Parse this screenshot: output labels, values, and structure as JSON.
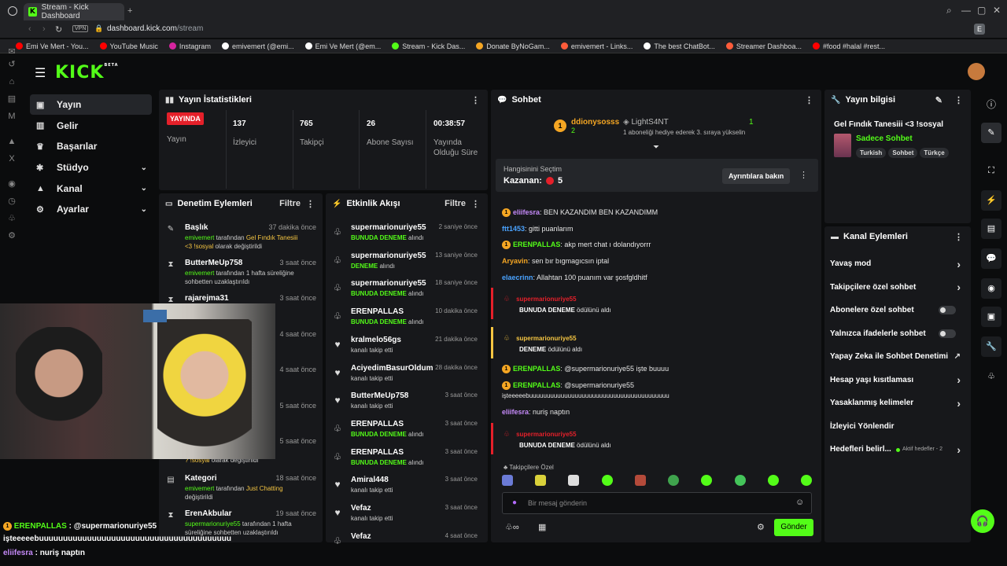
{
  "browser": {
    "tab_title": "Stream - Kick Dashboard",
    "url_host": "dashboard.kick.com",
    "url_path": "/stream",
    "vpn_label": "VPN",
    "profile_letter": "E",
    "bookmarks": [
      {
        "label": "Emi Ve Mert - You...",
        "color": "#ff0000"
      },
      {
        "label": "YouTube Music",
        "color": "#ff0000"
      },
      {
        "label": "Instagram",
        "color": "#d6249f"
      },
      {
        "label": "emivemert (@emi...",
        "color": "#ffffff"
      },
      {
        "label": "Emi Ve Mert (@em...",
        "color": "#ffffff"
      },
      {
        "label": "Stream - Kick Das...",
        "color": "#53fc18"
      },
      {
        "label": "Donate ByNoGam...",
        "color": "#f5a623"
      },
      {
        "label": "emivemert - Links...",
        "color": "#ff5c3a"
      },
      {
        "label": "The best ChatBot...",
        "color": "#ffffff"
      },
      {
        "label": "Streamer Dashboa...",
        "color": "#ff5c3a"
      },
      {
        "label": "#food #halal #rest...",
        "color": "#ff0000"
      }
    ]
  },
  "app": {
    "logo": "KICK",
    "logo_sup": "BETA",
    "accent": "#53fc18"
  },
  "nav": {
    "items": [
      {
        "label": "Yayın",
        "icon": "video-icon"
      },
      {
        "label": "Gelir",
        "icon": "chart-icon"
      },
      {
        "label": "Başarılar",
        "icon": "trophy-icon"
      },
      {
        "label": "Stüdyo",
        "icon": "studio-icon"
      },
      {
        "label": "Kanal",
        "icon": "channel-icon"
      },
      {
        "label": "Ayarlar",
        "icon": "gear-icon"
      }
    ]
  },
  "stats": {
    "title": "Yayın İstatistikleri",
    "live_badge": "YAYINDA",
    "live_label": "Yayın",
    "viewers_value": "137",
    "viewers_label": "İzleyici",
    "followers_value": "765",
    "followers_label": "Takipçi",
    "subs_value": "26",
    "subs_label": "Abone Sayısı",
    "duration_value": "00:38:57",
    "duration_label": "Yayında Olduğu Süre"
  },
  "moderation": {
    "title": "Denetim Eylemleri",
    "filter": "Filtre",
    "rows": [
      {
        "name": "Başlık",
        "time": "37 dakika önce",
        "line1_user": "emivemert",
        "line1_rest": " tarafından ",
        "line1_hl": "Gel Fındık Tanesiii",
        "line2": "<3 !sosyal",
        "line2_rest": " olarak değiştirildi"
      },
      {
        "name": "ButterMeUp758",
        "time": "3 saat önce",
        "line1_user": "emivemert",
        "line1_rest": " tarafından 1 hafta süreliğine",
        "line1_hl": "",
        "line2": "",
        "line2_rest": "sohbetten uzaklaştırıldı"
      },
      {
        "name": "rajarejma31",
        "time": "3 saat önce",
        "line1_user": "",
        "line1_rest": "1 hafta",
        "line1_hl": "",
        "line2": "",
        "line2_rest": "emi..."
      },
      {
        "name": "",
        "time": "4 saat önce",
        "line1_user": "",
        "line1_rest": "1 hafta",
        "line1_hl": "",
        "line2": "",
        "line2_rest": "ıldı"
      },
      {
        "name": "",
        "time": "4 saat önce",
        "line1_user": "",
        "line1_rest": "1 hafta",
        "line1_hl": "",
        "line2": "",
        "line2_rest": "ıldı"
      },
      {
        "name": "",
        "time": "5 saat önce",
        "line1_user": "",
        "line1_rest": "1 hafta",
        "line1_hl": "",
        "line2": "",
        "line2_rest": "ıldı"
      },
      {
        "name": "",
        "time": "5 saat önce",
        "line1_user": "",
        "line1_rest": "? Gün Arası",
        "line1_hl": "",
        "line2": "? !sosyal",
        "line2_rest": " olarak değiştirildi"
      },
      {
        "name": "Kategori",
        "time": "18 saat önce",
        "line1_user": "emivemert",
        "line1_rest": " tarafından ",
        "line1_hl": "Just Chatting",
        "line2": "",
        "line2_rest": "değiştirildi"
      },
      {
        "name": "ErenAkbular",
        "time": "19 saat önce",
        "line1_user": "supermarionuriye55",
        "line1_rest": " tarafından 1 hafta",
        "line1_hl": "",
        "line2": "",
        "line2_rest": "süreliğine sohbetten uzaklaştırıldı"
      }
    ],
    "extra_word": "olarak"
  },
  "events": {
    "title": "Etkinlik Akışı",
    "filter": "Filtre",
    "rows": [
      {
        "name": "supermarionuriye55",
        "time": "2 saniye önce",
        "hl": "BUNUDA DENEME",
        "rest": " alındı",
        "icon": "reward-icon"
      },
      {
        "name": "supermarionuriye55",
        "time": "13 saniye önce",
        "hl": "DENEME",
        "rest": " alındı",
        "icon": "reward-icon"
      },
      {
        "name": "supermarionuriye55",
        "time": "18 saniye önce",
        "hl": "BUNUDA DENEME",
        "rest": " alındı",
        "icon": "reward-icon"
      },
      {
        "name": "ERENPALLAS",
        "time": "10 dakika önce",
        "hl": "BUNUDA DENEME",
        "rest": " alındı",
        "icon": "reward-icon"
      },
      {
        "name": "kralmelo56gs",
        "time": "21 dakika önce",
        "hl": "",
        "rest": "kanalı takip etti",
        "icon": "heart-icon"
      },
      {
        "name": "AciyedimBasurOldum",
        "time": "28 dakika önce",
        "hl": "",
        "rest": "kanalı takip etti",
        "icon": "heart-icon"
      },
      {
        "name": "ButterMeUp758",
        "time": "3 saat önce",
        "hl": "",
        "rest": "kanalı takip etti",
        "icon": "heart-icon"
      },
      {
        "name": "ERENPALLAS",
        "time": "3 saat önce",
        "hl": "BUNUDA DENEME",
        "rest": " alındı",
        "icon": "reward-icon"
      },
      {
        "name": "ERENPALLAS",
        "time": "3 saat önce",
        "hl": "BUNUDA DENEME",
        "rest": " alındı",
        "icon": "reward-icon"
      },
      {
        "name": "Amiral448",
        "time": "3 saat önce",
        "hl": "",
        "rest": "kanalı takip etti",
        "icon": "heart-icon"
      },
      {
        "name": "Vefaz",
        "time": "3 saat önce",
        "hl": "",
        "rest": "kanalı takip etti",
        "icon": "heart-icon"
      },
      {
        "name": "Vefaz",
        "time": "4 saat önce",
        "hl": "",
        "rest": "",
        "icon": "reward-icon"
      }
    ]
  },
  "chat": {
    "title": "Sohbet",
    "pinned_gifter": "ddionysosss",
    "pinned_gifter_count": "2",
    "pinned_recipient": "LightS4NT",
    "pinned_recipient_count": "1",
    "pinned_text": "1 aboneliği hediye ederek 3. sıraya yükselin",
    "poll_title": "Hangisinini Seçtim",
    "poll_winner_label": "Kazanan:",
    "poll_winner_value": "5",
    "poll_button": "Ayrıntılara bakın",
    "messages": [
      {
        "user": "eliifesra",
        "user_color": "#c58af9",
        "text": "BEN KAZANDIM BEN KAZANDIMM"
      },
      {
        "user": "ftt1453",
        "user_color": "#4aa3ff",
        "text": "gitti puanlarım"
      },
      {
        "user": "ERENPALLAS",
        "user_color": "#53fc18",
        "text": "akp mert chat ı dolandıyorrr"
      },
      {
        "user": "Aryavin",
        "user_color": "#f5a623",
        "text": "sen bır bıgmagıcsın iptal"
      },
      {
        "user": "elaecrinn",
        "user_color": "#4aa3ff",
        "text": "Allahtan 100 puanım var şosfgldhitf"
      }
    ],
    "rewards": [
      {
        "user": "supermarionuriye55",
        "reward": "BUNUDA DENEME",
        "suffix": " ödülünü aldı"
      },
      {
        "user": "supermarionuriye55",
        "reward": "DENEME",
        "suffix": " ödülünü aldı"
      },
      {
        "user": "supermarionuriye55",
        "reward": "BUNUDA DENEME",
        "suffix": " ödülünü aldı"
      }
    ],
    "late_messages": [
      {
        "user": "ERENPALLAS",
        "text": "@supermarionuriye55 işte buuuu"
      },
      {
        "user": "ERENPALLAS",
        "text": "@supermarionuriye55"
      }
    ],
    "long_line": "işteeeeebuuuuuuuuuuuuuuuuuuuuuuuuuuuuuuuuuuuuuuuu",
    "last_msg_user": "eliifesra",
    "last_msg_text": "nuriş naptın",
    "followers_only": "Takipçilere Özel",
    "input_placeholder": "Bir mesaj gönderin",
    "send_label": "Gönder"
  },
  "stream_info": {
    "title": "Yayın bilgisi",
    "stream_title": "Gel Fındık Tanesiii <3 !sosyal",
    "category": "Sadece Sohbet",
    "tags": [
      "Turkish",
      "Sohbet",
      "Türkçe"
    ]
  },
  "channel_actions": {
    "title": "Kanal Eylemleri",
    "items": [
      {
        "label": "Yavaş mod",
        "kind": "chevron"
      },
      {
        "label": "Takipçilere özel sohbet",
        "kind": "chevron"
      },
      {
        "label": "Abonelere özel sohbet",
        "kind": "toggle"
      },
      {
        "label": "Yalnızca ifadelerle sohbet",
        "kind": "toggle"
      },
      {
        "label": "Yapay Zeka ile Sohbet Denetimi",
        "kind": "external"
      },
      {
        "label": "Hesap yaşı kısıtlaması",
        "kind": "chevron"
      },
      {
        "label": "Yasaklanmış kelimeler",
        "kind": "chevron"
      },
      {
        "label": "İzleyici Yönlendir",
        "kind": "none"
      },
      {
        "label": "Hedefleri belirl...",
        "kind": "chevron"
      }
    ],
    "goals_status": "Aktif hedefler - 2"
  },
  "overlay": {
    "line1_user": "ERENPALLAS",
    "line1_text": " : @supermarionuriye55",
    "line2": "işteeeeebuuuuuuuuuuuuuuuuuuuuuuuuuuuuuuuuuuuuuuuu",
    "line3_user": "eliifesra",
    "line3_text": " : nuriş naptın"
  }
}
